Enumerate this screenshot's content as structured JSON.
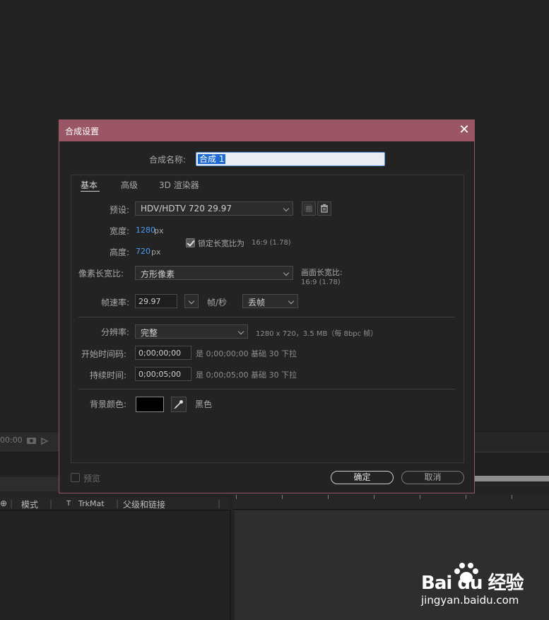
{
  "background": {
    "timecode": "00:00",
    "columns": {
      "mode": "模式",
      "t": "T",
      "trkmat": "TrkMat",
      "parent": "父级和链接"
    }
  },
  "dialog": {
    "title": "合成设置",
    "name_label": "合成名称:",
    "name_value": "合成 1",
    "tabs": [
      "基本",
      "高级",
      "3D 渲染器"
    ],
    "preset_label": "预设:",
    "preset_value": "HDV/HDTV 720 29.97",
    "width_label": "宽度:",
    "width_value": "1280",
    "height_label": "高度:",
    "height_value": "720",
    "px_unit": "px",
    "lock_label": "锁定长宽比为",
    "lock_ratio": "16:9 (1.78)",
    "pixel_ratio_label": "像素长宽比:",
    "pixel_ratio_value": "方形像素",
    "frame_ratio_label": "画面长宽比:",
    "frame_ratio_value": "16:9 (1.78)",
    "fps_label": "帧速率:",
    "fps_value": "29.97",
    "fps_unit": "帧/秒",
    "drop_frame_value": "丢帧",
    "resolution_label": "分辨率:",
    "resolution_value": "完整",
    "resolution_info": "1280 x 720，3.5 MB（每 8bpc 帧）",
    "start_tc_label": "开始时间码:",
    "start_tc_value": "0;00;00;00",
    "start_tc_info": "是 0;00;00;00  基础 30  下拉",
    "duration_label": "持续时间:",
    "duration_value": "0;00;05;00",
    "duration_info": "是 0;00;05;00  基础 30  下拉",
    "bg_color_label": "背景颜色:",
    "bg_color_name": "黑色",
    "bg_color_hex": "#000000",
    "preview_label": "预览",
    "ok_label": "确定",
    "cancel_label": "取消",
    "accent_color": "#9b5665"
  },
  "watermark": {
    "brand": "Bai du 经验",
    "url": "jingyan.baidu.com"
  }
}
